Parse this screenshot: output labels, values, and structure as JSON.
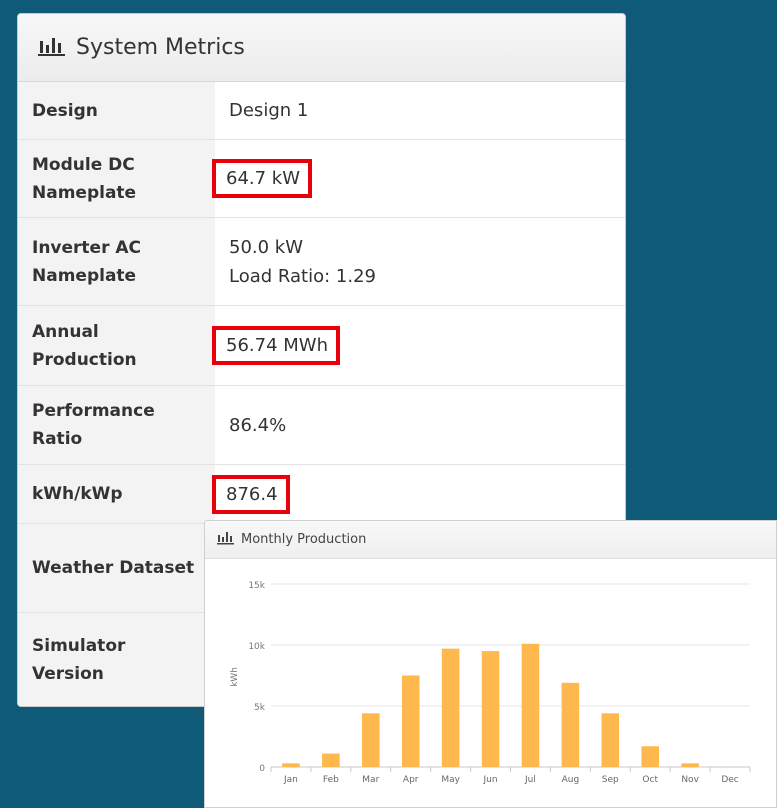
{
  "metrics": {
    "title": "System Metrics",
    "icon": "bar-chart-icon",
    "highlight_color": "#e8000b",
    "rows": [
      {
        "label": "Design",
        "value": "Design 1",
        "value2": "",
        "highlighted": false
      },
      {
        "label": "Module DC Nameplate",
        "value": "64.7 kW",
        "value2": "",
        "highlighted": true
      },
      {
        "label": "Inverter AC Nameplate",
        "value": "50.0 kW",
        "value2": "Load Ratio: 1.29",
        "highlighted": false
      },
      {
        "label": "Annual Production",
        "value": "56.74 MWh",
        "value2": "",
        "highlighted": true
      },
      {
        "label": "Performance Ratio",
        "value": "86.4%",
        "value2": "",
        "highlighted": false
      },
      {
        "label": "kWh/kWp",
        "value": "876.4",
        "value2": "",
        "highlighted": true
      },
      {
        "label": "Weather Dataset",
        "value": "",
        "value2": "",
        "highlighted": false
      },
      {
        "label": "Simulator Version",
        "value": "",
        "value2": "",
        "highlighted": false
      }
    ]
  },
  "monthly_chart": {
    "title": "Monthly Production",
    "icon": "bar-chart-icon"
  },
  "chart_data": {
    "type": "bar",
    "title": "Monthly Production",
    "xlabel": "",
    "ylabel": "kWh",
    "categories": [
      "Jan",
      "Feb",
      "Mar",
      "Apr",
      "May",
      "Jun",
      "Jul",
      "Aug",
      "Sep",
      "Oct",
      "Nov",
      "Dec"
    ],
    "values": [
      300,
      1100,
      4400,
      7500,
      9700,
      9500,
      10100,
      6900,
      4400,
      1700,
      300,
      0
    ],
    "ylim": [
      0,
      15000
    ],
    "yticks": [
      0,
      5000,
      10000,
      15000
    ],
    "ytick_labels": [
      "0",
      "5k",
      "10k",
      "15k"
    ],
    "bar_color": "#ffb84d",
    "grid": true
  }
}
